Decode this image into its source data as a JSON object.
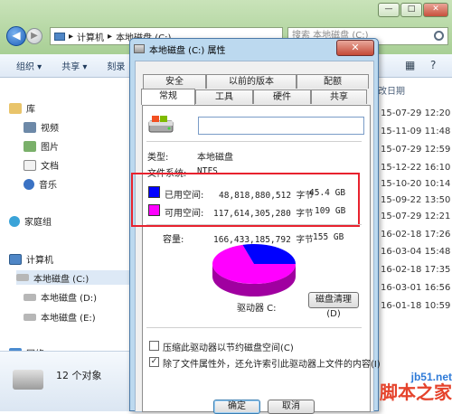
{
  "colors": {
    "used": "#0000ff",
    "free": "#ff00ff",
    "accent": "#e8222e"
  },
  "window_controls": {
    "minimize": "—",
    "maximize": "□",
    "close": "✕"
  },
  "explorer": {
    "address": [
      "计算机",
      "本地磁盘 (C:)"
    ],
    "search_placeholder": "搜索 本地磁盘 (C:)",
    "toolbar": {
      "organize": "组织",
      "share": "共享",
      "burn": "刻录"
    },
    "sidebar": {
      "library": "库",
      "videos": "视频",
      "pictures": "图片",
      "documents": "文档",
      "music": "音乐",
      "homegroup": "家庭组",
      "computer": "计算机",
      "drive_c": "本地磁盘 (C:)",
      "drive_d": "本地磁盘 (D:)",
      "drive_e": "本地磁盘 (E:)",
      "network": "网络"
    },
    "item_count": "12 个对象",
    "date_header": "改日期",
    "dates": [
      "15-07-29 12:20",
      "15-11-09 11:48",
      "15-07-29 12:59",
      "15-12-22 16:10",
      "15-10-20 10:14",
      "15-09-22 13:50",
      "15-07-29 12:21",
      "16-02-18 17:26",
      "16-03-04 15:48",
      "16-02-18 17:35",
      "16-03-01 16:56",
      "16-01-18 10:59"
    ]
  },
  "dialog": {
    "title": "本地磁盘 (C:) 属性",
    "tabs_row1": [
      "安全",
      "以前的版本",
      "配额"
    ],
    "tabs_row2": [
      "常规",
      "工具",
      "硬件",
      "共享"
    ],
    "name_value": "",
    "type_label": "类型:",
    "type_value": "本地磁盘",
    "fs_label": "文件系统:",
    "fs_value": "NTFS",
    "used_label": "已用空间:",
    "used_bytes": "48,818,880,512 字节",
    "used_size": "45.4 GB",
    "free_label": "可用空间:",
    "free_bytes": "117,614,305,280 字节",
    "free_size": "109 GB",
    "capacity_label": "容量:",
    "capacity_bytes": "166,433,185,792 字节",
    "capacity_size": "155 GB",
    "drive_label": "驱动器 C:",
    "cleanup": "磁盘清理(D)",
    "compress_label": "压缩此驱动器以节约磁盘空间(C)",
    "compress_checked": false,
    "index_label": "除了文件属性外，还允许索引此驱动器上文件的内容(I)",
    "index_checked": true,
    "ok": "确定",
    "cancel": "取消"
  },
  "chart_data": {
    "type": "pie",
    "categories": [
      "已用空间",
      "可用空间"
    ],
    "values": [
      45.4,
      109
    ],
    "colors": [
      "#0000ff",
      "#ff00ff"
    ]
  },
  "watermark": {
    "site": "jb51.net",
    "name": "脚本之家"
  }
}
